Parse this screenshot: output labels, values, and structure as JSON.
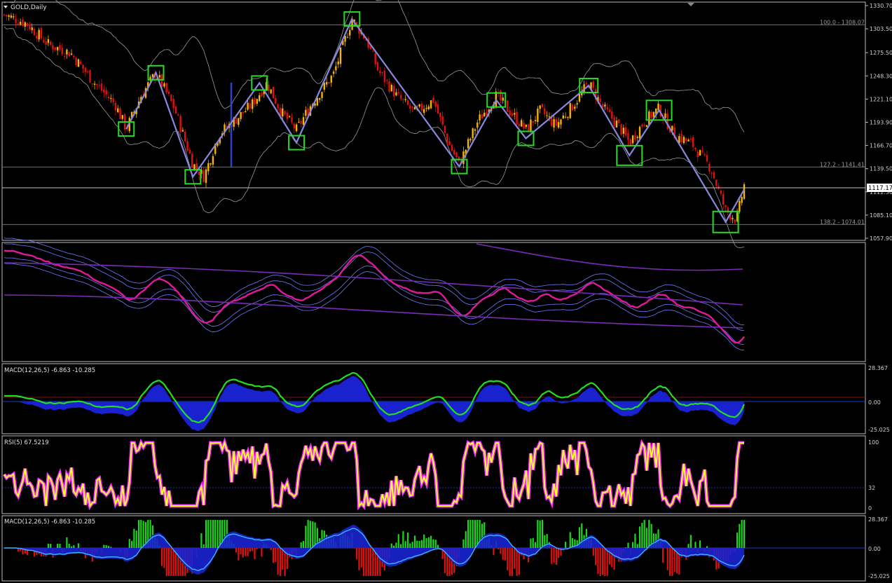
{
  "colors": {
    "background": "#000000",
    "frame": "#c8c8c8",
    "axis_text": "#d0d0d0",
    "bull": "#f5b400",
    "bear": "#e01010",
    "band": "#9a9a9a",
    "zigzag": "#8888dd",
    "box": "#22dd22",
    "env_fast": "#e0199a",
    "env_band": "#6f79ff",
    "env_long": "#7a2bb8",
    "macd_fill": "#1a22d0",
    "macd_line": "#22dd22",
    "rsi_main": "#ffff30",
    "rsi_glow": "#ff30ff",
    "hist_up": "#1ed51e",
    "hist_down": "#e01010",
    "signal": "#39b6ff"
  },
  "main_panel": {
    "title": "GOLD,Daily",
    "price_ticks": [
      "1330.70",
      "1303.50",
      "1275.50",
      "1248.30",
      "1221.10",
      "1193.90",
      "1166.70",
      "1139.50",
      "1112.30",
      "1085.10",
      "1057.90"
    ],
    "current_price": "1117.17",
    "fib_levels": [
      {
        "label": "100.0 - 1308.07",
        "price": 1308.07
      },
      {
        "label": "127.2 - 1141.41",
        "price": 1141.41
      },
      {
        "label": "138.2 - 1074.01",
        "price": 1074.01
      }
    ]
  },
  "panel2": {
    "label": ""
  },
  "panel3": {
    "label": "MACD(12,26,5) -6.863 -10.285",
    "ticks": [
      "28.367",
      "0.00",
      "-25.025"
    ]
  },
  "panel4": {
    "label": "RSI(5) 67.5219",
    "ticks": [
      "100",
      "32",
      "0"
    ]
  },
  "panel5": {
    "label": "MACD(12,26,5) -6.863 -10.285",
    "ticks": [
      "28.367",
      "0.00",
      "-25.025"
    ]
  },
  "chart_data": {
    "type": "candlestick",
    "symbol": "GOLD",
    "timeframe": "Daily",
    "ylim": [
      1057.9,
      1330.7
    ],
    "close_path": [
      [
        0,
        1320
      ],
      [
        0.03,
        1310
      ],
      [
        0.06,
        1285
      ],
      [
        0.09,
        1275
      ],
      [
        0.12,
        1242
      ],
      [
        0.15,
        1215
      ],
      [
        0.165,
        1186
      ],
      [
        0.185,
        1225
      ],
      [
        0.205,
        1252
      ],
      [
        0.23,
        1210
      ],
      [
        0.255,
        1145
      ],
      [
        0.27,
        1130
      ],
      [
        0.29,
        1180
      ],
      [
        0.31,
        1195
      ],
      [
        0.335,
        1215
      ],
      [
        0.355,
        1240
      ],
      [
        0.375,
        1205
      ],
      [
        0.395,
        1185
      ],
      [
        0.415,
        1215
      ],
      [
        0.445,
        1250
      ],
      [
        0.47,
        1315
      ],
      [
        0.49,
        1290
      ],
      [
        0.505,
        1255
      ],
      [
        0.53,
        1225
      ],
      [
        0.555,
        1205
      ],
      [
        0.58,
        1220
      ],
      [
        0.6,
        1170
      ],
      [
        0.615,
        1145
      ],
      [
        0.64,
        1195
      ],
      [
        0.665,
        1225
      ],
      [
        0.685,
        1205
      ],
      [
        0.705,
        1185
      ],
      [
        0.725,
        1208
      ],
      [
        0.745,
        1190
      ],
      [
        0.77,
        1215
      ],
      [
        0.79,
        1240
      ],
      [
        0.81,
        1210
      ],
      [
        0.83,
        1190
      ],
      [
        0.845,
        1170
      ],
      [
        0.865,
        1195
      ],
      [
        0.885,
        1210
      ],
      [
        0.905,
        1180
      ],
      [
        0.93,
        1168
      ],
      [
        0.955,
        1140
      ],
      [
        0.975,
        1090
      ],
      [
        0.99,
        1080
      ],
      [
        1.0,
        1120
      ]
    ],
    "zigzag": [
      [
        0.165,
        1186
      ],
      [
        0.205,
        1252
      ],
      [
        0.255,
        1130
      ],
      [
        0.345,
        1240
      ],
      [
        0.395,
        1170
      ],
      [
        0.47,
        1315
      ],
      [
        0.615,
        1142
      ],
      [
        0.665,
        1220
      ],
      [
        0.705,
        1175
      ],
      [
        0.79,
        1237
      ],
      [
        0.845,
        1155
      ],
      [
        0.885,
        1208
      ],
      [
        0.975,
        1077
      ],
      [
        1.0,
        1115
      ]
    ],
    "pivot_boxes": [
      [
        0.165,
        1186
      ],
      [
        0.205,
        1252
      ],
      [
        0.255,
        1130
      ],
      [
        0.345,
        1240
      ],
      [
        0.395,
        1170
      ],
      [
        0.47,
        1315
      ],
      [
        0.615,
        1142
      ],
      [
        0.665,
        1220
      ],
      [
        0.705,
        1175
      ],
      [
        0.79,
        1237
      ],
      [
        0.845,
        1155
      ],
      [
        0.885,
        1208
      ],
      [
        0.975,
        1077
      ]
    ],
    "rsi_period": 5,
    "rsi_last": 67.5219,
    "macd_params": [
      12,
      26,
      5
    ],
    "macd_last": -6.863,
    "macd_signal_last": -10.285
  }
}
